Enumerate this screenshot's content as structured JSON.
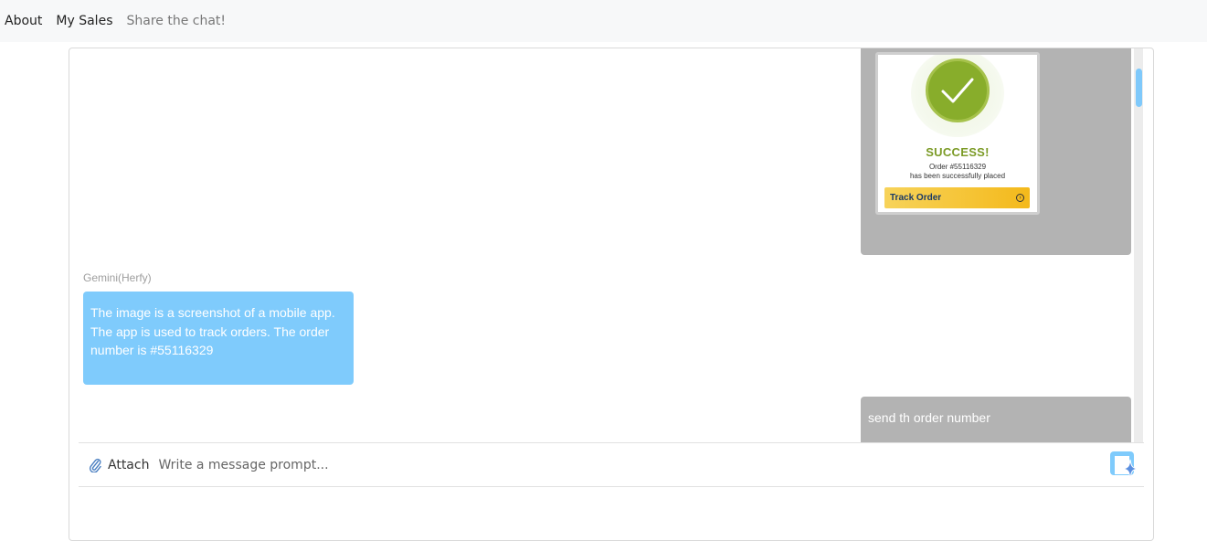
{
  "nav": {
    "about": "About",
    "my_sales": "My Sales",
    "share": "Share the chat!"
  },
  "messages": {
    "user_image": {
      "success_title": "SUCCESS!",
      "order_line": "Order #55116329",
      "placed_line": "has been successfully placed",
      "track_button": "Track Order"
    },
    "bot": {
      "sender": "Gemini(Herfy)",
      "text": "The image is a screenshot of a mobile app. The app is used to track orders. The order number is #55116329"
    },
    "user_text": {
      "text": "send th order number"
    }
  },
  "composer": {
    "attach_label": "Attach",
    "placeholder": "Write a message prompt...",
    "attach_icon": "paperclip-icon",
    "send_icon": "gemini-sparkle-send-icon"
  },
  "colors": {
    "bot_bubble": "#7fcbfc",
    "user_bubble": "#b3b3b3",
    "accent": "#7fc9fb",
    "success_green": "#88ad2b"
  }
}
